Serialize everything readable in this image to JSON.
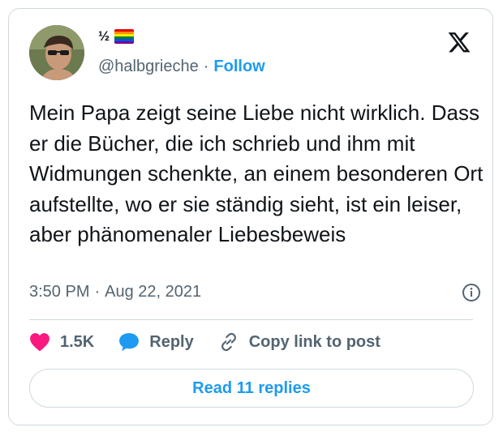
{
  "author": {
    "display_name": "½",
    "handle": "@halbgrieche",
    "separator": "·",
    "follow_label": "Follow"
  },
  "tweet": {
    "text": "Mein Papa zeigt seine Liebe nicht wirklich. Dass er die Bücher, die ich schrieb und ihm mit Widmungen schenkte, an einem besonderen Ort aufstellte, wo er sie ständig sieht, ist ein leiser, aber phänomenaler Liebesbeweis",
    "time": "3:50 PM",
    "separator": "·",
    "date": "Aug 22, 2021"
  },
  "actions": {
    "likes": "1.5K",
    "reply_label": "Reply",
    "copy_label": "Copy link to post"
  },
  "read_replies_label": "Read 11 replies",
  "icons": {
    "brand": "x-logo-icon",
    "info": "info-icon",
    "like": "heart-icon",
    "reply": "speech-bubble-icon",
    "copy": "link-icon"
  },
  "colors": {
    "accent": "#1d9bf0",
    "heart": "#f91880",
    "muted_text": "#536471",
    "border": "#cfd9de",
    "flag": [
      "#e40303",
      "#ff8c00",
      "#ffed00",
      "#008026",
      "#004dff",
      "#750787"
    ]
  }
}
